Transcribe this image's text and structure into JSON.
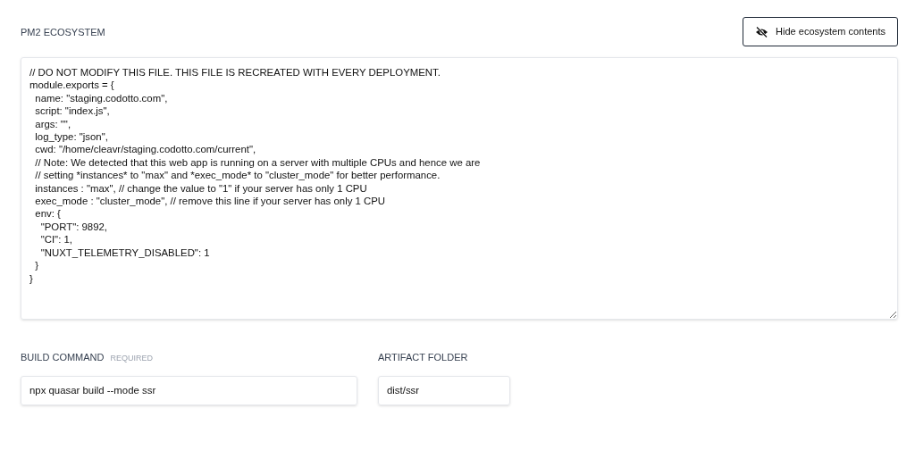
{
  "ecosystem": {
    "label": "PM2 ECOSYSTEM",
    "toggle_button": "Hide ecosystem contents",
    "content": [
      "// DO NOT MODIFY THIS FILE. THIS FILE IS RECREATED WITH EVERY DEPLOYMENT.",
      "module.exports = {",
      "  name: \"staging.codotto.com\",",
      "  script: \"index.js\",",
      "  args: \"\",",
      "  log_type: \"json\",",
      "  cwd: \"/home/cleavr/staging.codotto.com/current\",",
      "  // Note: We detected that this web app is running on a server with multiple CPUs and hence we are",
      "  // setting *instances* to \"max\" and *exec_mode* to \"cluster_mode\" for better performance.",
      "  instances : \"max\", // change the value to \"1\" if your server has only 1 CPU",
      "  exec_mode : \"cluster_mode\", // remove this line if your server has only 1 CPU",
      "  env: {",
      "    \"PORT\": 9892,",
      "    \"CI\": 1,",
      "    \"NUXT_TELEMETRY_DISABLED\": 1",
      "  }",
      "}"
    ]
  },
  "build_command": {
    "label": "BUILD COMMAND",
    "required_tag": "REQUIRED",
    "value": "npx quasar build --mode ssr"
  },
  "artifact_folder": {
    "label": "ARTIFACT FOLDER",
    "value": "dist/ssr"
  }
}
